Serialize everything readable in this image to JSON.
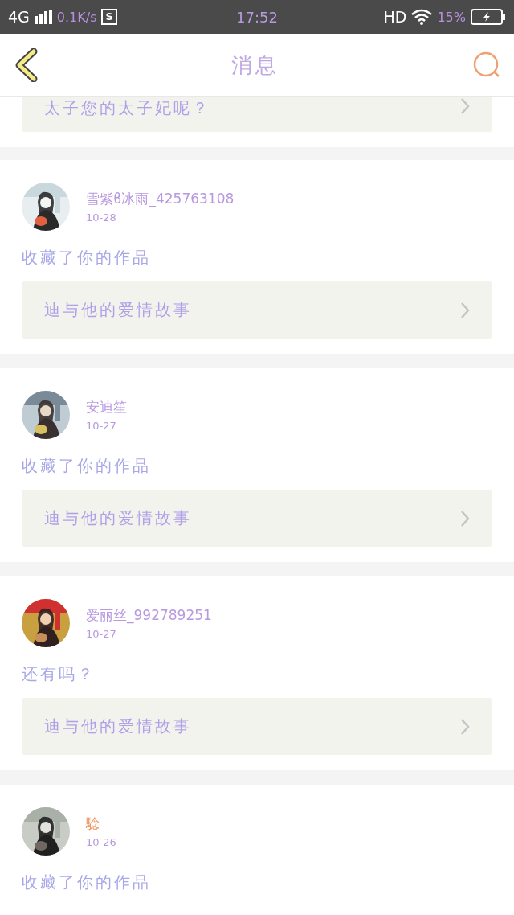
{
  "status_bar": {
    "network": "4G",
    "speed": "0.1K/s",
    "app_badge": "S",
    "time": "17:52",
    "hd": "HD",
    "battery": "15%"
  },
  "header": {
    "title": "消息"
  },
  "partial_top": {
    "link": "太子您的太子妃呢？"
  },
  "messages": [
    {
      "name": "雪紫ϐ冰雨_425763108",
      "color": "#b898e0",
      "date": "10-28",
      "text": "收藏了你的作品",
      "link": "迪与他的爱情故事"
    },
    {
      "name": "安迪笙",
      "color": "#b898e0",
      "date": "10-27",
      "text": "收藏了你的作品",
      "link": "迪与他的爱情故事"
    },
    {
      "name": "爱丽丝_992789251",
      "color": "#b898e0",
      "date": "10-27",
      "text": "还有吗？",
      "link": "迪与他的爱情故事"
    },
    {
      "name": "騐",
      "color": "#f0905a",
      "date": "10-26",
      "text": "收藏了你的作品"
    }
  ]
}
